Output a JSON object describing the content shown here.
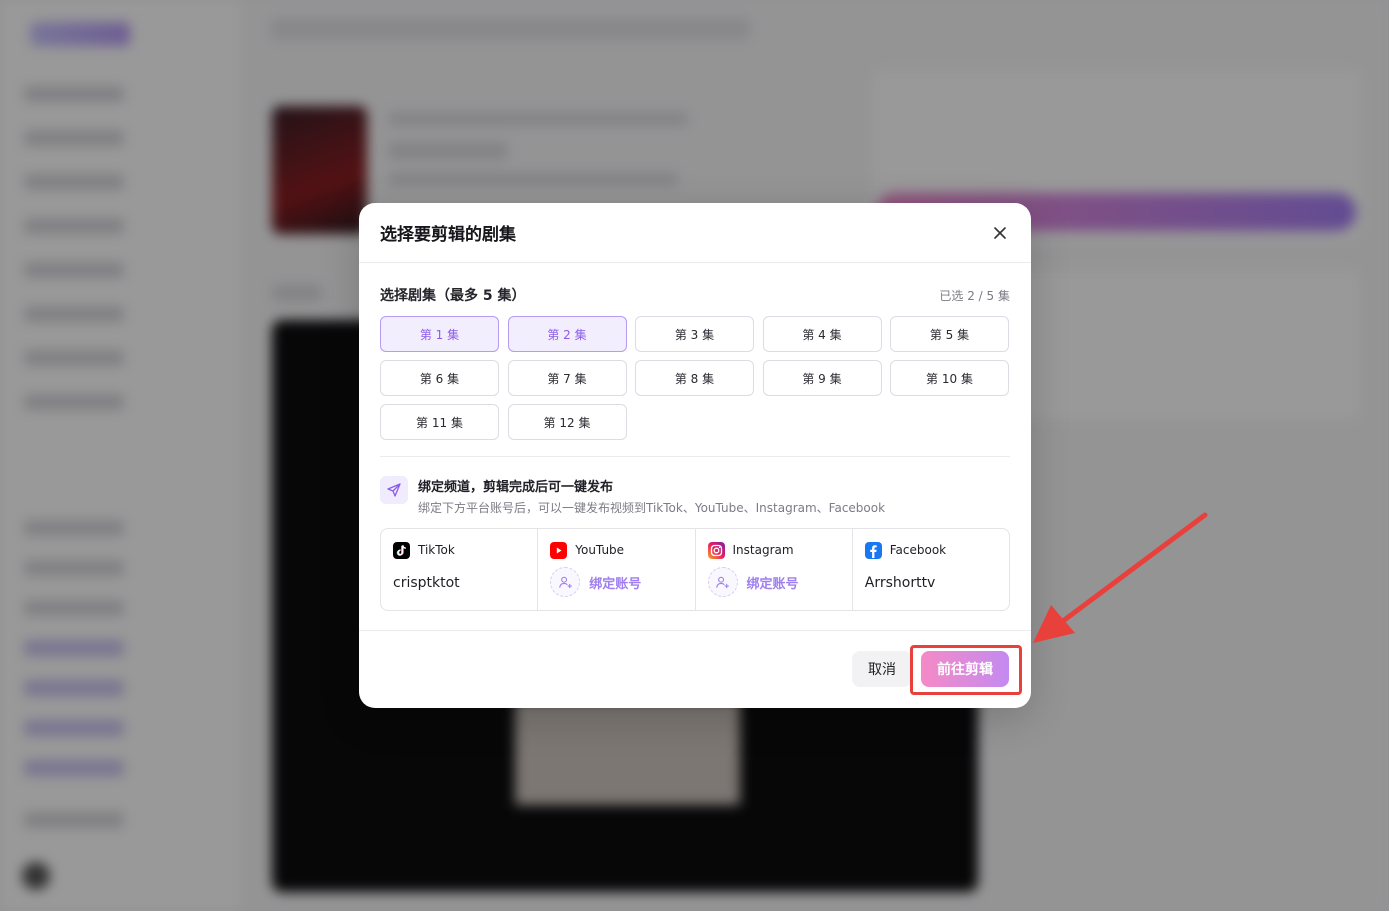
{
  "modal": {
    "title": "选择要剪辑的剧集",
    "section_label": "选择剧集（最多 5 集）",
    "selected_count": "已选 2 / 5 集",
    "episodes": [
      {
        "label": "第 1 集",
        "selected": true
      },
      {
        "label": "第 2 集",
        "selected": true
      },
      {
        "label": "第 3 集",
        "selected": false
      },
      {
        "label": "第 4 集",
        "selected": false
      },
      {
        "label": "第 5 集",
        "selected": false
      },
      {
        "label": "第 6 集",
        "selected": false
      },
      {
        "label": "第 7 集",
        "selected": false
      },
      {
        "label": "第 8 集",
        "selected": false
      },
      {
        "label": "第 9 集",
        "selected": false
      },
      {
        "label": "第 10 集",
        "selected": false
      },
      {
        "label": "第 11 集",
        "selected": false
      },
      {
        "label": "第 12 集",
        "selected": false
      }
    ],
    "bind": {
      "title": "绑定频道，剪辑完成后可一键发布",
      "description": "绑定下方平台账号后，可以一键发布视频到TikTok、YouTube、Instagram、Facebook"
    },
    "platforms": [
      {
        "name": "TikTok",
        "icon": "tiktok-icon",
        "account": "crisptktot",
        "bound": true
      },
      {
        "name": "YouTube",
        "icon": "youtube-icon",
        "bind_label": "绑定账号",
        "bound": false
      },
      {
        "name": "Instagram",
        "icon": "instagram-icon",
        "bind_label": "绑定账号",
        "bound": false
      },
      {
        "name": "Facebook",
        "icon": "facebook-icon",
        "account": "Arrshorttv",
        "bound": true
      }
    ],
    "cancel_label": "取消",
    "confirm_label": "前往剪辑"
  },
  "colors": {
    "accent": "#8c5ce8",
    "gradient_start": "#f58ac6",
    "gradient_end": "#c38af0",
    "annotation": "#e8413c"
  }
}
